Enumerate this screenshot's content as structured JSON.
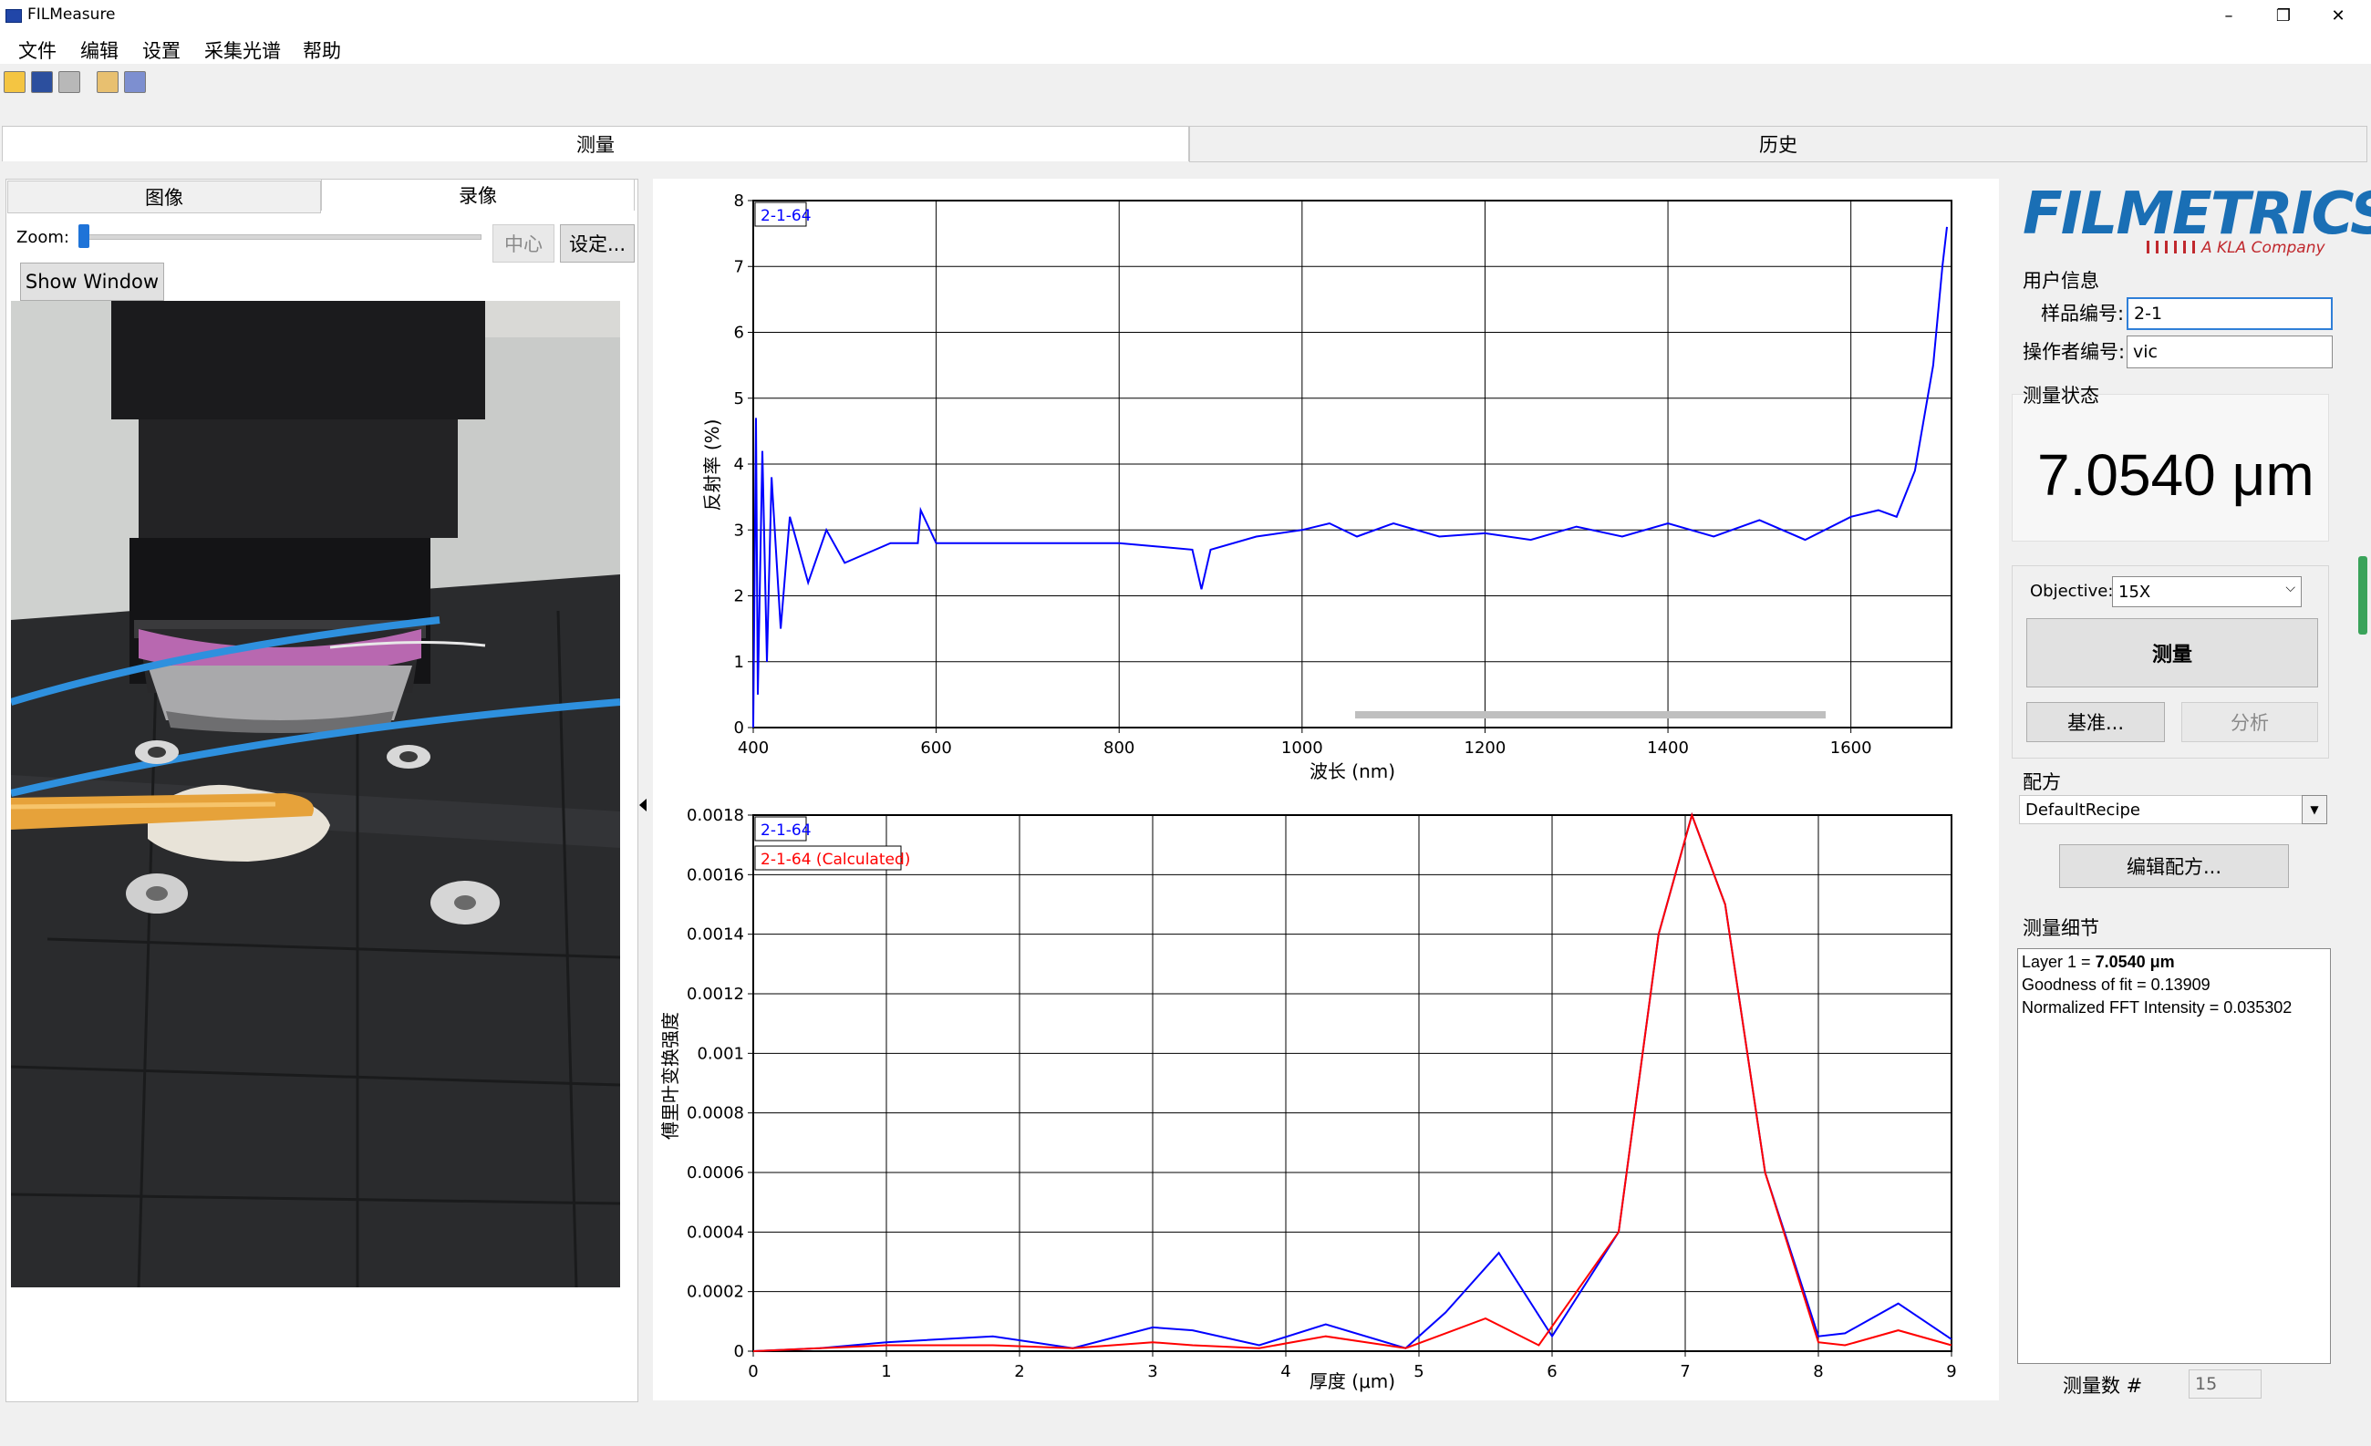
{
  "window": {
    "title": "FILMeasure",
    "min": "–",
    "max": "❐",
    "close": "✕"
  },
  "menu": [
    "文件",
    "编辑",
    "设置",
    "采集光谱",
    "帮助"
  ],
  "main_tabs": [
    "测量",
    "历史"
  ],
  "camera": {
    "tabs": [
      "图像",
      "录像"
    ],
    "zoom_label": "Zoom:",
    "zoom_value": 0,
    "center_button": "中心",
    "settings_button": "设定...",
    "show_window_button": "Show Window"
  },
  "reflectance_chart": {
    "legend": "2-1-64",
    "xlabel": "波长 (nm)",
    "ylabel": "反射率 (%)",
    "x_ticks": [
      "400",
      "600",
      "800",
      "1000",
      "1200",
      "1400",
      "1600"
    ],
    "y_ticks": [
      "0",
      "1",
      "2",
      "3",
      "4",
      "5",
      "6",
      "7",
      "8"
    ]
  },
  "fft_chart": {
    "legend_measured": "2-1-64",
    "legend_calculated": "2-1-64 (Calculated)",
    "xlabel": "厚度 (μm)",
    "ylabel": "傅里叶变换强度",
    "x_ticks": [
      "0",
      "1",
      "2",
      "3",
      "4",
      "5",
      "6",
      "7",
      "8",
      "9"
    ],
    "y_ticks": [
      "0",
      "0.0002",
      "0.0004",
      "0.0006",
      "0.0008",
      "0.001",
      "0.0012",
      "0.0014",
      "0.0016",
      "0.0018"
    ]
  },
  "chart_data": [
    {
      "type": "line",
      "xlabel": "波长 (nm)",
      "ylabel": "反射率 (%)",
      "xlim": [
        400,
        1710
      ],
      "ylim": [
        0,
        8
      ],
      "series": [
        {
          "name": "2-1-64",
          "color": "#0000ff",
          "x": [
            400,
            403,
            405,
            410,
            415,
            420,
            430,
            440,
            460,
            480,
            500,
            550,
            580,
            583,
            600,
            700,
            800,
            880,
            890,
            900,
            950,
            1000,
            1030,
            1060,
            1100,
            1150,
            1200,
            1250,
            1300,
            1350,
            1400,
            1450,
            1500,
            1550,
            1600,
            1630,
            1650,
            1670,
            1690,
            1700,
            1705
          ],
          "y": [
            0.0,
            4.7,
            0.5,
            4.2,
            1.0,
            3.8,
            1.5,
            3.2,
            2.2,
            3.0,
            2.5,
            2.8,
            2.8,
            3.3,
            2.8,
            2.8,
            2.8,
            2.7,
            2.1,
            2.7,
            2.9,
            3.0,
            3.1,
            2.9,
            3.1,
            2.9,
            2.95,
            2.85,
            3.05,
            2.9,
            3.1,
            2.9,
            3.15,
            2.85,
            3.2,
            3.3,
            3.2,
            3.9,
            5.5,
            7.0,
            7.6
          ]
        }
      ]
    },
    {
      "type": "line",
      "xlabel": "厚度 (μm)",
      "ylabel": "傅里叶变换强度",
      "xlim": [
        0,
        9
      ],
      "ylim": [
        0,
        0.0018
      ],
      "series": [
        {
          "name": "2-1-64",
          "color": "#0000ff",
          "x": [
            0,
            0.5,
            1.0,
            1.8,
            2.4,
            3.0,
            3.3,
            3.8,
            4.3,
            4.9,
            5.2,
            5.6,
            6.0,
            6.5,
            6.8,
            7.05,
            7.3,
            7.6,
            8.0,
            8.2,
            8.6,
            9.0
          ],
          "y": [
            0.0,
            1e-05,
            3e-05,
            5e-05,
            1e-05,
            8e-05,
            7e-05,
            2e-05,
            9e-05,
            1e-05,
            0.00013,
            0.00033,
            5e-05,
            0.0004,
            0.0014,
            0.0018,
            0.0015,
            0.0006,
            5e-05,
            6e-05,
            0.00016,
            4e-05
          ]
        },
        {
          "name": "2-1-64 (Calculated)",
          "color": "#ff0000",
          "x": [
            0,
            0.5,
            1.0,
            1.8,
            2.4,
            3.0,
            3.3,
            3.8,
            4.3,
            4.9,
            5.2,
            5.5,
            5.9,
            6.5,
            6.8,
            7.05,
            7.3,
            7.6,
            8.0,
            8.2,
            8.6,
            9.0
          ],
          "y": [
            0.0,
            1e-05,
            2e-05,
            2e-05,
            1e-05,
            3e-05,
            2e-05,
            1e-05,
            5e-05,
            1e-05,
            6e-05,
            0.00011,
            2e-05,
            0.0004,
            0.0014,
            0.0018,
            0.0015,
            0.0006,
            3e-05,
            2e-05,
            7e-05,
            2e-05
          ]
        }
      ]
    }
  ],
  "right_panel": {
    "logo": "FILMETRICS",
    "logo_sub": "A KLA Company",
    "user_info_title": "用户信息",
    "sample_label": "样品编号:",
    "sample_value": "2-1",
    "operator_label": "操作者编号:",
    "operator_value": "vic",
    "status_title": "测量状态",
    "result": "7.0540 μm",
    "objective_label": "Objective:",
    "objective_value": "15X",
    "measure_button": "测量",
    "baseline_button": "基准...",
    "analyze_button": "分析",
    "recipe_title": "配方",
    "recipe_value": "DefaultRecipe",
    "edit_recipe_button": "编辑配方...",
    "details_title": "测量细节",
    "details": {
      "layer_prefix": "Layer 1 = ",
      "layer_value": "7.0540 μm",
      "goodness": "Goodness of fit = 0.13909",
      "fft": "Normalized FFT Intensity = 0.035302"
    },
    "count_label": "测量数 #",
    "count_value": "15"
  },
  "colors": {
    "accent": "#1a6fb5",
    "measured": "#0000ff",
    "calculated": "#ff0000",
    "scroll_thumb": "#3aa35a"
  }
}
